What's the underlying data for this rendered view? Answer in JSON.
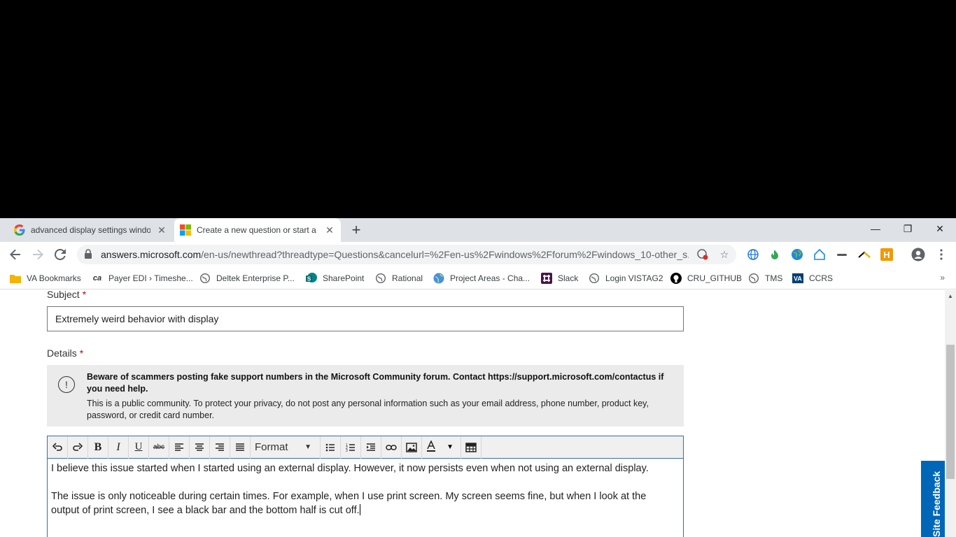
{
  "browser": {
    "tabs": [
      {
        "title": "advanced display settings windo",
        "favicon": "google-icon",
        "active": false
      },
      {
        "title": "Create a new question or start a",
        "favicon": "microsoft-icon",
        "active": true
      }
    ],
    "new_tab": "+",
    "url_host": "answers.microsoft.com",
    "url_path": "/en-us/newthread?threadtype=Questions&cancelurl=%2Fen-us%2Fwindows%2Fforum%2Fwindows_10-other_s...",
    "window_controls": {
      "minimize": "—",
      "restore": "❐",
      "close": "✕"
    }
  },
  "bookmarks": [
    {
      "label": "VA Bookmarks",
      "icon": "folder-icon",
      "color": "#f4b400"
    },
    {
      "label": "Payer EDI › Timeshe...",
      "icon": "ca-icon",
      "color": "#333333"
    },
    {
      "label": "Deltek Enterprise P...",
      "icon": "globe-icon",
      "color": "#5f6368"
    },
    {
      "label": "SharePoint",
      "icon": "sharepoint-icon",
      "color": "#038387"
    },
    {
      "label": "Rational",
      "icon": "globe-icon",
      "color": "#5f6368"
    },
    {
      "label": "Project Areas - Cha...",
      "icon": "globe-blue-icon",
      "color": "#4a90d9"
    },
    {
      "label": "Slack",
      "icon": "slack-icon",
      "color": "#4a154b"
    },
    {
      "label": "Login VISTAG2",
      "icon": "globe-icon",
      "color": "#5f6368"
    },
    {
      "label": "CRU_GITHUB",
      "icon": "github-icon",
      "color": "#000000"
    },
    {
      "label": "TMS",
      "icon": "globe-icon",
      "color": "#5f6368"
    },
    {
      "label": "CCRS",
      "icon": "va-icon",
      "color": "#003f72"
    }
  ],
  "bookmarks_more": "»",
  "form": {
    "subject_label": "Subject",
    "required_mark": "*",
    "subject_value": "Extremely weird behavior with display",
    "details_label": "Details",
    "notice_warning": "Beware of scammers posting fake support numbers in the Microsoft Community forum. Contact https://support.microsoft.com/contactus if you need help.",
    "notice_info": "This is a public community. To protect your privacy, do not post any personal information such as your email address, phone number, product key, password, or credit card number."
  },
  "editor": {
    "format_label": "Format",
    "bold": "B",
    "italic": "I",
    "underline": "U",
    "strike": "abc",
    "paragraph1": "I believe this issue started when I started using an external display. However, it now persists even when not using an external display.",
    "paragraph2": "The issue is only noticeable during certain times. For example, when I use print screen. My screen seems fine, but when I look at the output of print screen, I see a black bar and the bottom half is cut off."
  },
  "site_feedback": "Site Feedback",
  "colors": {
    "accent": "#0067b8",
    "editor_border": "#3a6ea5",
    "notice_bg": "#ebebeb"
  }
}
